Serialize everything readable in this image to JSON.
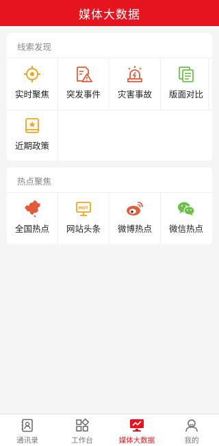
{
  "header": {
    "title": "媒体大数据"
  },
  "clues": {
    "title": "线索发现",
    "items": [
      {
        "label": "实时聚焦",
        "icon": "crosshair-icon"
      },
      {
        "label": "突发事件",
        "icon": "alert-document-icon"
      },
      {
        "label": "灾害事故",
        "icon": "siren-icon"
      },
      {
        "label": "版面对比",
        "icon": "layout-compare-icon"
      },
      {
        "label": "近期政策",
        "icon": "policy-book-icon"
      }
    ]
  },
  "hotspots": {
    "title": "热点聚焦",
    "items": [
      {
        "label": "全国热点",
        "icon": "china-map-icon"
      },
      {
        "label": "网站头条",
        "icon": "hot-monitor-icon"
      },
      {
        "label": "微博热点",
        "icon": "weibo-icon"
      },
      {
        "label": "微信热点",
        "icon": "wechat-icon"
      }
    ]
  },
  "tabbar": {
    "items": [
      {
        "label": "通讯录",
        "icon": "contacts-icon",
        "active": false
      },
      {
        "label": "工作台",
        "icon": "workbench-icon",
        "active": false
      },
      {
        "label": "媒体大数据",
        "icon": "media-data-icon",
        "active": true
      },
      {
        "label": "我的",
        "icon": "profile-icon",
        "active": false
      }
    ]
  },
  "colors": {
    "brand": "#e5141e",
    "orange": "#f0a41f",
    "icon_red": "#e25c3a",
    "icon_green": "#6cc04a"
  }
}
